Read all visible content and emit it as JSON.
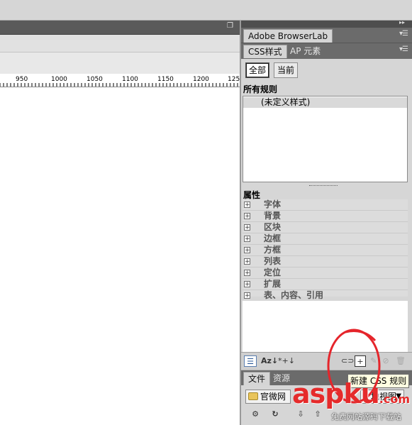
{
  "document": {
    "ruler_ticks": [
      "950",
      "1000",
      "1050",
      "1100",
      "1150",
      "1200",
      "125"
    ]
  },
  "panels": {
    "browserlab_tab": "Adobe BrowserLab",
    "css_tabs": [
      "CSS样式",
      "AP 元素"
    ],
    "mode_buttons": [
      "全部",
      "当前"
    ],
    "all_rules_header": "所有规则",
    "rules": [
      "(未定义样式)"
    ],
    "properties_header": "属性",
    "property_categories": [
      "字体",
      "背景",
      "区块",
      "边框",
      "方框",
      "列表",
      "定位",
      "扩展",
      "表、内容、引用"
    ],
    "bottom_tools": [
      "list-view-icon",
      "az-sort-icon",
      "set-properties-icon",
      "attach-stylesheet-icon",
      "new-css-rule-icon",
      "edit-icon",
      "disable-icon",
      "trash-icon"
    ],
    "files_tabs": [
      "文件",
      "资源"
    ],
    "site_select": "官微网",
    "view_select": "地视图",
    "tooltip": "新建 CSS 规则"
  },
  "watermark": {
    "text": "aspku",
    "suffix": ".com",
    "sub": "免费网站源码下载站"
  },
  "colors": {
    "annotation": "#e5252b",
    "watermark": "#e52b2b"
  }
}
